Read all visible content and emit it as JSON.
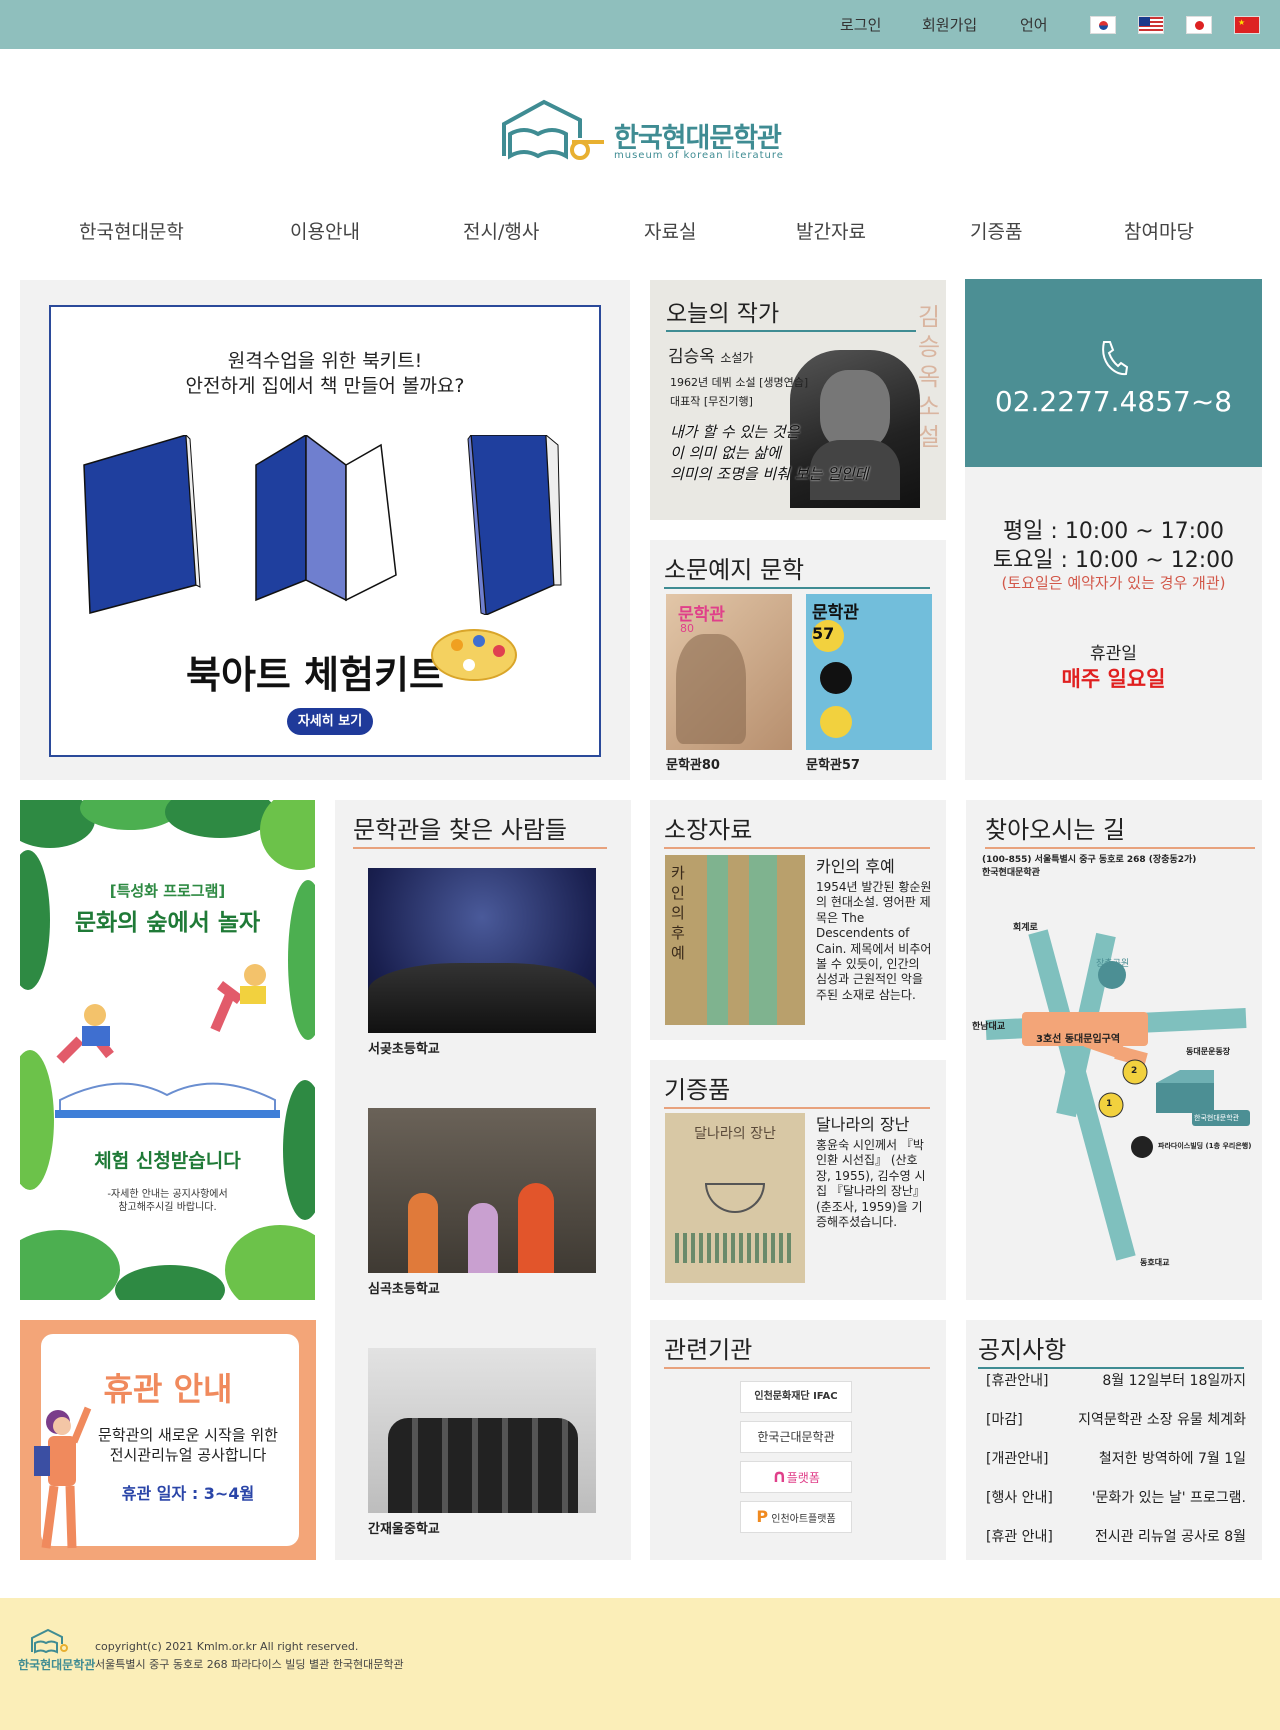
{
  "topbar": {
    "login": "로그인",
    "signup": "회원가입",
    "language": "언어"
  },
  "logo": {
    "title": "한국현대문학관",
    "subtitle": "museum of korean literature"
  },
  "nav": [
    "한국현대문학",
    "이용안내",
    "전시/행사",
    "자료실",
    "발간자료",
    "기증품",
    "참여마당"
  ],
  "banner": {
    "line1": "원격수업을 위한 북키트!",
    "line2": "안전하게 집에서 책 만들어 볼까요?",
    "headline": "북아트 체험키트",
    "button": "자세히 보기"
  },
  "author": {
    "title": "오늘의 작가",
    "name": "김승옥",
    "role": "소설가",
    "debut": "1962년 데뷔 소설 [생명연습]",
    "work": "대표작 [무진기행]",
    "quote1": "내가 할 수 있는 것은",
    "quote2": "이 의미 없는 삶에",
    "quote3": "의미의 조명을 비춰 보는 일인데",
    "side_text": "김승옥 소설"
  },
  "phone": {
    "number": "02.2277.4857~8"
  },
  "hours": {
    "weekday": "평일 : 10:00 ~ 17:00",
    "saturday": "토요일 : 10:00 ~ 12:00",
    "note": "(토요일은 예약자가 있는 경우 개관)",
    "closed_label": "휴관일",
    "closed_day": "매주 일요일"
  },
  "magazine": {
    "title": "소문예지 문학",
    "items": [
      {
        "cover_title": "문학관",
        "issue": "80",
        "caption": "문학관80"
      },
      {
        "cover_title": "문학관",
        "issue": "57",
        "caption": "문학관57"
      }
    ]
  },
  "program": {
    "tag": "[특성화 프로그램]",
    "title": "문화의 숲에서 놀자",
    "apply": "체험 신청받습니다",
    "note1": "-자세한 안내는 공지사항에서",
    "note2": "참고해주시길 바랍니다."
  },
  "visitors": {
    "title": "문학관을 찾은 사람들",
    "items": [
      "서곶초등학교",
      "심곡초등학교",
      "간재울중학교"
    ]
  },
  "collection": {
    "title": "소장자료",
    "cover_text": "카인의 후예",
    "item_title": "카인의 후예",
    "desc": "1954년 발간된 황순원의 현대소설. 영어판 제목은 The Descendents of Cain. 제목에서 비추어 볼 수 있듯이, 인간의 심성과 근원적인 악을 주된 소재로 삼는다."
  },
  "donation": {
    "title": "기증품",
    "cover_text": "달나라의 장난",
    "item_title": "달나라의 장난",
    "desc": "홍윤숙 시인께서 『박인환 시선집』 (산호장, 1955), 김수영 시집 『달나라의 장난』 (춘조사, 1959)을 기증해주셨습니다."
  },
  "directions": {
    "title": "찾아오시는 길",
    "address1": "(100-855) 서울특별시 중구 동호로 268 (장충동2가)",
    "address2": "한국현대문학관",
    "labels": {
      "hoegye": "회계로",
      "jangchung": "장충공원",
      "hannam": "한남대교",
      "station": "3호선 동대문입구역",
      "dongdaemun": "동대문운동장",
      "museum": "한국현대문학관",
      "paradise": "파라다이스빌딩 (1층 우리은행)",
      "dongho": "동호대교",
      "exit1": "1",
      "exit2": "2"
    }
  },
  "closure": {
    "title": "휴관 안내",
    "line1": "문학관의 새로운 시작을 위한",
    "line2": "전시관리뉴얼 공사합니다",
    "dates": "휴관 일자 : 3~4월"
  },
  "related": {
    "title": "관련기관",
    "orgs": [
      "인천문화재단 IFAC",
      "한국근대문학관",
      "플랫폼",
      "인천아트플랫폼"
    ]
  },
  "notices": {
    "title": "공지사항",
    "items": [
      {
        "tag": "[휴관안내]",
        "text": "8월 12일부터 18일까지"
      },
      {
        "tag": "[마감]",
        "text": "지역문학관 소장 유물 체계화"
      },
      {
        "tag": "[개관안내]",
        "text": "철저한 방역하에 7월 1일"
      },
      {
        "tag": "[행사 안내]",
        "text": "'문화가 있는 날' 프로그램."
      },
      {
        "tag": "[휴관 안내]",
        "text": "전시관 리뉴얼 공사로 8월"
      }
    ]
  },
  "footer": {
    "logo_text": "한국현대문학관",
    "copyright": "copyright(c) 2021 Kmlm.or.kr All right reserved.",
    "address": "서울특별시 중구 동호로 268 파라다이스 빌딩 별관 한국현대문학관"
  }
}
